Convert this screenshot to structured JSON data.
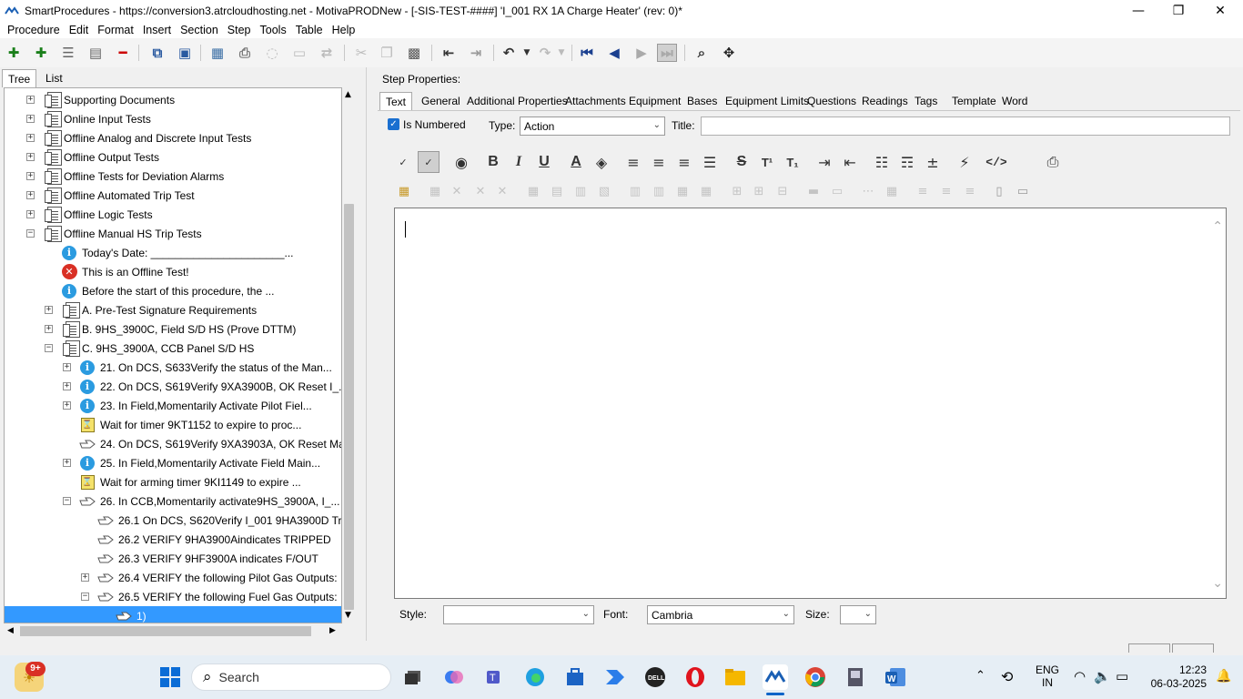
{
  "window": {
    "title": "SmartProcedures - https://conversion3.atrcloudhosting.net - MotivaPRODNew - [-SIS-TEST-####] 'I_001 RX 1A Charge Heater' (rev: 0)*",
    "minimize": "—",
    "maximize": "❐",
    "close": "✕"
  },
  "menu": [
    "Procedure",
    "Edit",
    "Format",
    "Insert",
    "Section",
    "Step",
    "Tools",
    "Table",
    "Help"
  ],
  "left_tabs": {
    "tree": "Tree",
    "list": "List"
  },
  "tree": [
    {
      "label": "Supporting Documents"
    },
    {
      "label": "Online Input Tests"
    },
    {
      "label": "Offline Analog and Discrete Input Tests"
    },
    {
      "label": "Offline Output Tests"
    },
    {
      "label": "Offline Tests for Deviation Alarms"
    },
    {
      "label": "Offline Automated Trip Test"
    },
    {
      "label": "Offline Logic Tests"
    },
    {
      "label": "Offline Manual HS Trip Tests"
    },
    {
      "label": "Today's Date: ______________________..."
    },
    {
      "label": "This is an Offline Test!"
    },
    {
      "label": "Before the start of this procedure, the ..."
    },
    {
      "label": "A. Pre-Test Signature Requirements"
    },
    {
      "label": "B. 9HS_3900C, Field S/D HS (Prove DTTM)"
    },
    {
      "label": "C. 9HS_3900A, CCB Panel S/D HS"
    },
    {
      "label": "21. On DCS, S633Verify the status of the Man..."
    },
    {
      "label": "22. On DCS, S619Verify 9XA3900B, OK Reset I_..."
    },
    {
      "label": "23. In Field,Momentarily Activate Pilot Fiel..."
    },
    {
      "label": "Wait for timer 9KT1152 to expire to proc..."
    },
    {
      "label": "24. On DCS, S619Verify 9XA3903A, OK Reset Ma..."
    },
    {
      "label": "25. In Field,Momentarily Activate Field Main..."
    },
    {
      "label": "Wait for arming timer 9KI1149 to expire ..."
    },
    {
      "label": "26. In CCB,Momentarily activate9HS_3900A, I_..."
    },
    {
      "label": "26.1 On DCS, S620Verify I_001 9HA3900D Tri..."
    },
    {
      "label": "26.2 VERIFY 9HA3900Aindicates TRIPPED"
    },
    {
      "label": "26.3 VERIFY 9HF3900A indicates F/OUT"
    },
    {
      "label": "26.4 VERIFY the following Pilot Gas Outputs:"
    },
    {
      "label": "26.5 VERIFY the following Fuel Gas Outputs:"
    },
    {
      "label": "1)"
    }
  ],
  "step_properties": {
    "heading": "Step Properties:",
    "tabs": [
      "Text",
      "General",
      "Additional Properties",
      "Attachments",
      "Equipment",
      "Bases",
      "Equipment Limits",
      "Questions",
      "Readings",
      "Tags",
      "Template",
      "Word"
    ],
    "is_numbered_label": "Is Numbered",
    "is_numbered": true,
    "type_label": "Type:",
    "type_value": "Action",
    "title_label": "Title:",
    "title_value": ""
  },
  "format_bar": {
    "bold": "B",
    "italic": "I",
    "underline": "U",
    "font_color": "A",
    "strike": "S",
    "superscript": "T¹",
    "subscript": "T₁",
    "code": "</>"
  },
  "bottom": {
    "style_label": "Style:",
    "style_value": "",
    "font_label": "Font:",
    "font_value": "Cambria",
    "size_label": "Size:",
    "size_value": ""
  },
  "taskbar": {
    "search": "Search",
    "badge": "9+",
    "lang1": "ENG",
    "lang2": "IN",
    "time": "12:23",
    "date": "06-03-2025"
  },
  "colors": {
    "selection": "#3399ff",
    "accent": "#0a64c8"
  }
}
